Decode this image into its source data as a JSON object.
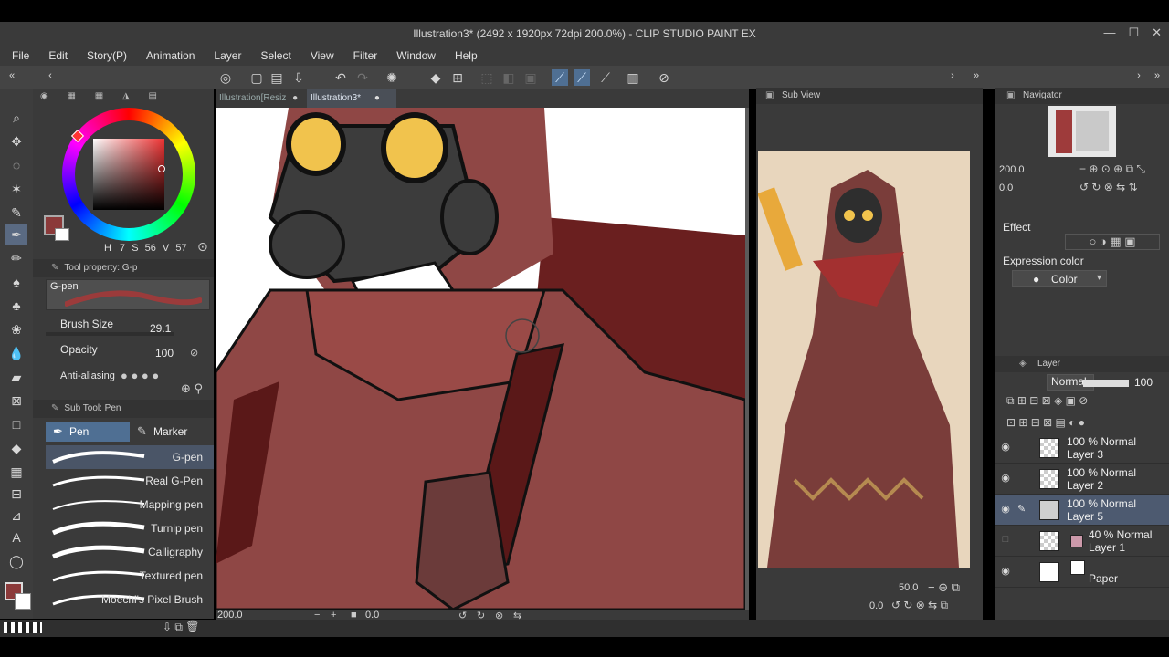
{
  "window": {
    "title": "Illustration3* (2492 x 1920px 72dpi 200.0%)  - CLIP STUDIO PAINT EX"
  },
  "menu": [
    "File",
    "Edit",
    "Story(P)",
    "Animation",
    "Layer",
    "Select",
    "View",
    "Filter",
    "Window",
    "Help"
  ],
  "tabs": [
    {
      "label": "Illustration[Resiz"
    },
    {
      "label": "Illustration3*"
    }
  ],
  "color": {
    "main": "#8b3a3a",
    "values": {
      "h": "7",
      "s": "56",
      "v": "57"
    },
    "labels": {
      "h": "H",
      "s": "S",
      "v": "V"
    }
  },
  "tool_property": {
    "header": "Tool property: G-p",
    "brush_name": "G-pen",
    "brush_size_label": "Brush Size",
    "brush_size_value": "29.1",
    "opacity_label": "Opacity",
    "opacity_value": "100",
    "antialias_label": "Anti-aliasing"
  },
  "sub_tool": {
    "header": "Sub Tool: Pen",
    "tabs": [
      "Pen",
      "Marker"
    ],
    "brushes": [
      "G-pen",
      "Real G-Pen",
      "Mapping pen",
      "Turnip pen",
      "Calligraphy",
      "Textured pen",
      "Moechi's Pixel Brush"
    ]
  },
  "canvas": {
    "zoom": "200.0",
    "rotation": "0.0"
  },
  "sub_view": {
    "header": "Sub View",
    "zoom": "50.0",
    "rotation": "0.0"
  },
  "navigator": {
    "header": "Navigator",
    "zoom": "200.0",
    "rotation": "0.0"
  },
  "effect": {
    "header": "Effect",
    "expression_label": "Expression color",
    "expression_value": "Color"
  },
  "layer_panel": {
    "header": "Layer",
    "blend_mode": "Normal",
    "opacity": "100",
    "layers": [
      {
        "line1": "100 % Normal",
        "line2": "Layer 3"
      },
      {
        "line1": "100 % Normal",
        "line2": "Layer 2"
      },
      {
        "line1": "100 % Normal",
        "line2": "Layer 5"
      },
      {
        "line1": "40 % Normal",
        "line2": "Layer 1"
      },
      {
        "line1": "",
        "line2": "Paper"
      }
    ]
  }
}
